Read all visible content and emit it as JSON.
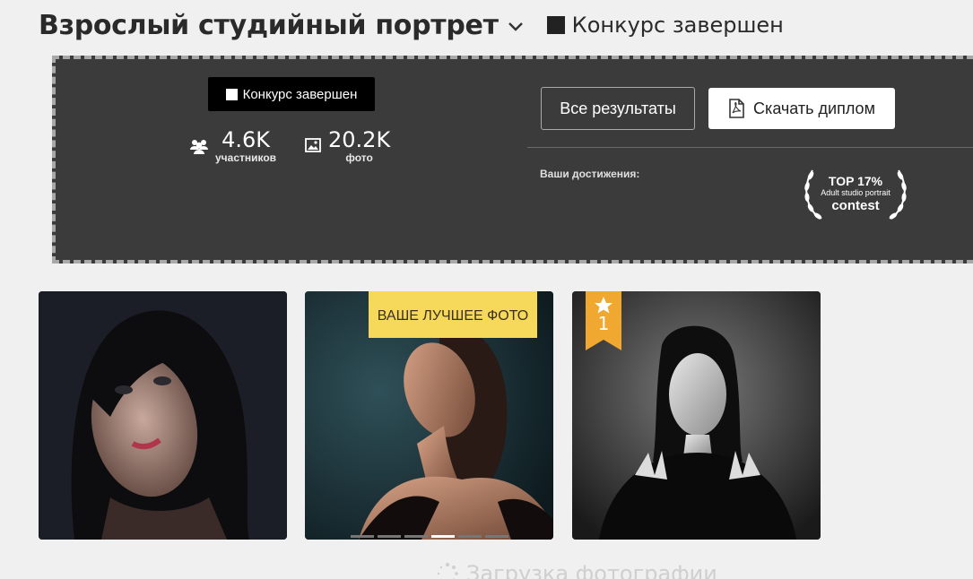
{
  "header": {
    "title": "Взрослый студийный портрет",
    "status": "Конкурс завершен"
  },
  "panel": {
    "status_pill": "Конкурс завершен",
    "stats": {
      "participants": {
        "value": "4.6K",
        "label": "участников"
      },
      "photos": {
        "value": "20.2K",
        "label": "фото"
      }
    },
    "buttons": {
      "all_results": "Все результаты",
      "download_diploma": "Скачать диплом"
    },
    "achievements_label": "Ваши достижения:",
    "badge": {
      "top": "TOP 17%",
      "subtitle": "Adult studio portrait",
      "contest": "contest"
    }
  },
  "photos": [
    {
      "tag": ""
    },
    {
      "tag": "ВАШЕ ЛУЧШЕЕ ФОТО",
      "carousel_count": 6,
      "carousel_active": 4
    },
    {
      "rank": "1"
    }
  ],
  "loading_text": "Загрузка фотографии",
  "colors": {
    "page_bg": "#f0f0f0",
    "panel_bg": "#3b3b3b",
    "best_tag": "#f6d85a",
    "rank_ribbon": "#f0a830"
  }
}
